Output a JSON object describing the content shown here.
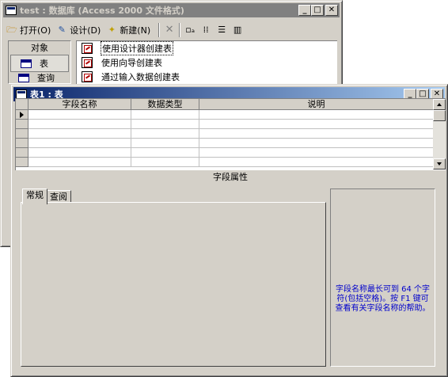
{
  "db_window": {
    "title": "test : 数据库 (Access 2000 文件格式)",
    "toolbar": {
      "open_label": "打开(O)",
      "design_label": "设计(D)",
      "new_label": "新建(N)"
    },
    "objects_header": "对象",
    "objects": [
      {
        "label": "表",
        "selected": true
      },
      {
        "label": "查询"
      }
    ],
    "list_items": [
      "使用设计器创建表",
      "使用向导创建表",
      "通过输入数据创建表"
    ]
  },
  "table_window": {
    "title": "表1 : 表",
    "columns": [
      "字段名称",
      "数据类型",
      "说明"
    ],
    "row_count": 6,
    "field_properties_label": "字段属性",
    "tabs": [
      "常规",
      "查阅"
    ],
    "active_tab": "常规",
    "help_text": "字段名称最长可到 64 个字符(包括空格)。按 F1 键可查看有关字段名称的帮助。"
  },
  "colors": {
    "active_title_start": "#0a246a",
    "active_title_end": "#a6caf0",
    "inactive_title": "#808080",
    "face": "#d4d0c8",
    "help_text": "#0000cc"
  }
}
